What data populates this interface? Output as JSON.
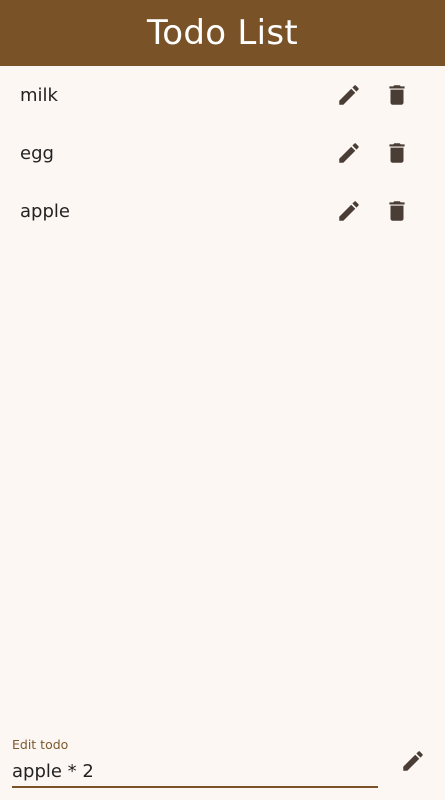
{
  "app_bar": {
    "title": "Todo List",
    "color": "#7a5227"
  },
  "todos": [
    {
      "text": "milk",
      "edit_icon": "pencil-icon",
      "delete_icon": "trash-icon"
    },
    {
      "text": "egg",
      "edit_icon": "pencil-icon",
      "delete_icon": "trash-icon"
    },
    {
      "text": "apple",
      "edit_icon": "pencil-icon",
      "delete_icon": "trash-icon"
    }
  ],
  "edit_field": {
    "label": "Edit todo",
    "value": "apple * 2",
    "submit_icon": "pencil-icon"
  },
  "colors": {
    "background": "#fdf7f3",
    "icon": "#4a3d36",
    "accent": "#7a5227"
  }
}
